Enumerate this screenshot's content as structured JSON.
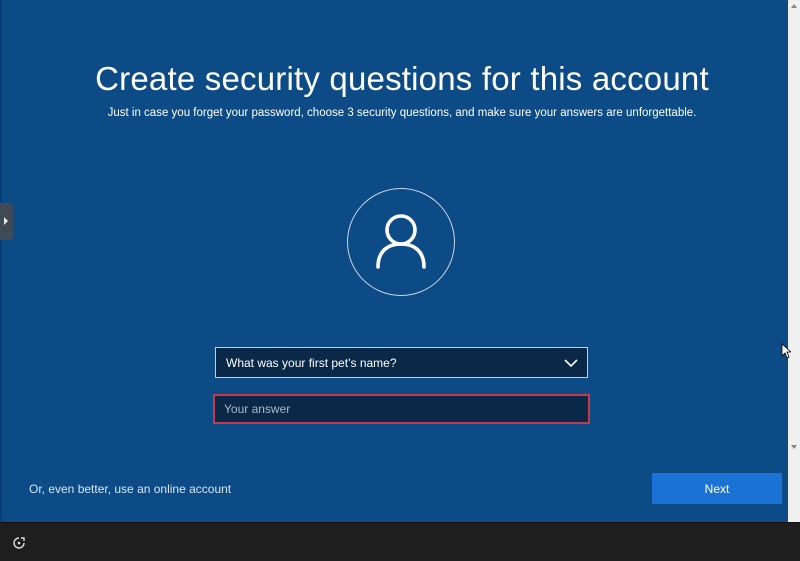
{
  "page": {
    "title": "Create security questions for this account",
    "subtitle": "Just in case you forget your password, choose 3 security questions, and make sure your answers are unforgettable."
  },
  "avatar": {
    "icon": "user-icon"
  },
  "security_question": {
    "selected": "What was your first pet’s name?",
    "icon": "chevron-down-icon"
  },
  "answer": {
    "value": "",
    "placeholder": "Your answer"
  },
  "footer": {
    "online_account_link": "Or, even better, use an online account",
    "next_label": "Next"
  },
  "taskbar": {
    "icon": "accessibility-icon"
  },
  "colors": {
    "background": "#0c4b86",
    "accent": "#1a73d4",
    "error_border": "#c9394a",
    "field_background": "#0a2847"
  }
}
